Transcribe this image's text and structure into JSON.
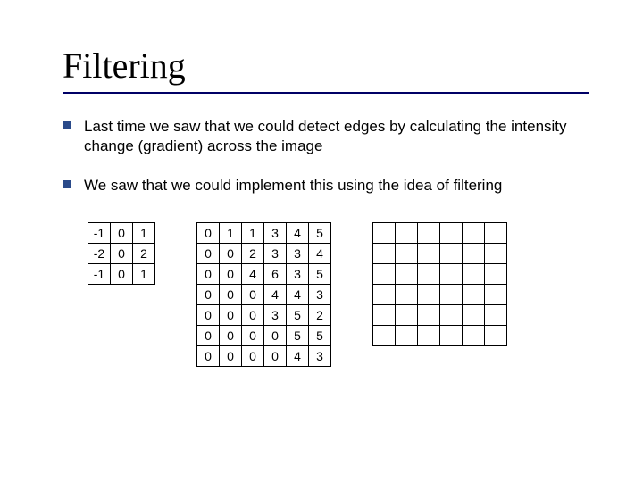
{
  "title": "Filtering",
  "bullets": [
    "Last time we saw that we could detect edges by calculating the intensity change (gradient) across the image",
    "We saw that we could implement this using the idea of filtering"
  ],
  "kernel": [
    [
      "-1",
      "0",
      "1"
    ],
    [
      "-2",
      "0",
      "2"
    ],
    [
      "-1",
      "0",
      "1"
    ]
  ],
  "image_grid": [
    [
      "0",
      "1",
      "1",
      "3",
      "4",
      "5"
    ],
    [
      "0",
      "0",
      "2",
      "3",
      "3",
      "4"
    ],
    [
      "0",
      "0",
      "4",
      "6",
      "3",
      "5"
    ],
    [
      "0",
      "0",
      "0",
      "4",
      "4",
      "3"
    ],
    [
      "0",
      "0",
      "0",
      "3",
      "5",
      "2"
    ],
    [
      "0",
      "0",
      "0",
      "0",
      "5",
      "5"
    ],
    [
      "0",
      "0",
      "0",
      "0",
      "4",
      "3"
    ]
  ],
  "empty_grid": {
    "rows": 6,
    "cols": 6
  },
  "colors": {
    "accent": "#2a4a8a",
    "rule": "#000066"
  }
}
